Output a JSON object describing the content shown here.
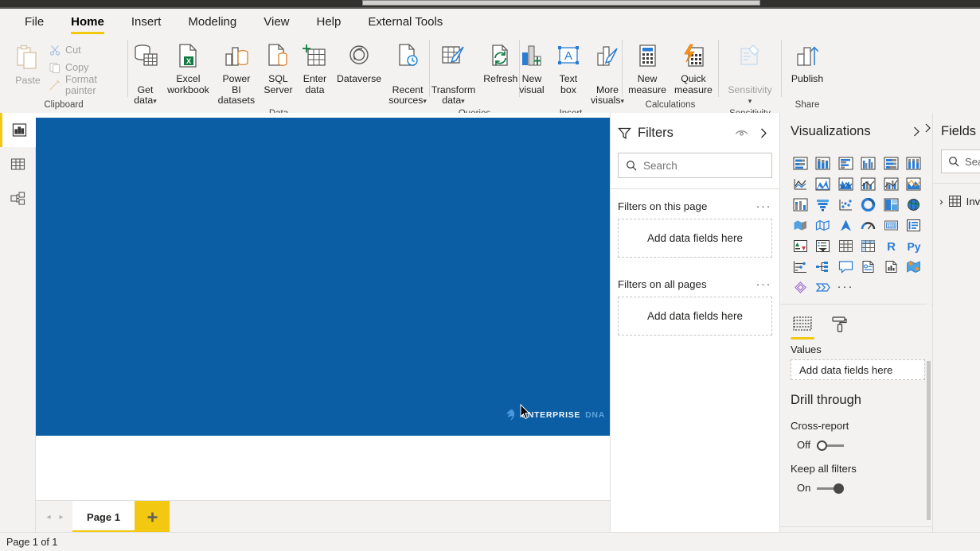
{
  "titlebar": {
    "segment": ""
  },
  "ribbon": {
    "tabs": [
      {
        "label": "File",
        "active": false
      },
      {
        "label": "Home",
        "active": true
      },
      {
        "label": "Insert",
        "active": false
      },
      {
        "label": "Modeling",
        "active": false
      },
      {
        "label": "View",
        "active": false
      },
      {
        "label": "Help",
        "active": false
      },
      {
        "label": "External Tools",
        "active": false
      }
    ],
    "groups": [
      {
        "name": "Clipboard",
        "label": "Clipboard",
        "paste": {
          "label": "Paste",
          "icon": "paste-icon"
        },
        "small": [
          {
            "label": "Cut",
            "icon": "cut-icon"
          },
          {
            "label": "Copy",
            "icon": "copy-icon"
          },
          {
            "label": "Format painter",
            "icon": "format-painter-icon"
          }
        ]
      },
      {
        "name": "Data",
        "label": "Data",
        "buttons": [
          {
            "label": "Get\ndata",
            "icon": "get-data-icon",
            "chevron": true
          },
          {
            "label": "Excel\nworkbook",
            "icon": "excel-workbook-icon",
            "chevron": false
          },
          {
            "label": "Power BI\ndatasets",
            "icon": "power-bi-datasets-icon",
            "chevron": false
          },
          {
            "label": "SQL\nServer",
            "icon": "sql-server-icon",
            "chevron": false
          },
          {
            "label": "Enter\ndata",
            "icon": "enter-data-icon",
            "chevron": false
          },
          {
            "label": "Dataverse",
            "icon": "dataverse-icon",
            "chevron": false
          },
          {
            "label": "Recent\nsources",
            "icon": "recent-sources-icon",
            "chevron": true
          }
        ]
      },
      {
        "name": "Queries",
        "label": "Queries",
        "buttons": [
          {
            "label": "Transform\ndata",
            "icon": "transform-data-icon",
            "chevron": true
          },
          {
            "label": "Refresh",
            "icon": "refresh-icon",
            "chevron": false
          }
        ]
      },
      {
        "name": "Insert",
        "label": "Insert",
        "buttons": [
          {
            "label": "New\nvisual",
            "icon": "new-visual-icon",
            "chevron": false
          },
          {
            "label": "Text\nbox",
            "icon": "text-box-icon",
            "chevron": false
          },
          {
            "label": "More\nvisuals",
            "icon": "more-visuals-icon",
            "chevron": true
          }
        ]
      },
      {
        "name": "Calculations",
        "label": "Calculations",
        "buttons": [
          {
            "label": "New\nmeasure",
            "icon": "new-measure-icon",
            "chevron": false
          },
          {
            "label": "Quick\nmeasure",
            "icon": "quick-measure-icon",
            "chevron": false
          }
        ]
      },
      {
        "name": "Sensitivity",
        "label": "Sensitivity",
        "buttons": [
          {
            "label": "Sensitivity",
            "icon": "sensitivity-icon",
            "chevron": true,
            "disabled": true
          }
        ]
      },
      {
        "name": "Share",
        "label": "Share",
        "buttons": [
          {
            "label": "Publish",
            "icon": "publish-icon",
            "chevron": false
          }
        ]
      }
    ]
  },
  "left_rail": [
    {
      "name": "report-view",
      "icon": "report-view-icon",
      "active": true
    },
    {
      "name": "data-view",
      "icon": "data-view-icon",
      "active": false
    },
    {
      "name": "model-view",
      "icon": "model-view-icon",
      "active": false
    }
  ],
  "canvas": {
    "background_color": "#0B5EA3",
    "watermark": {
      "primary": "ENTERPRISE",
      "secondary": "DNA",
      "logo": "enterprise-dna-logo"
    }
  },
  "page_tabs": {
    "prev": "◂",
    "next": "▸",
    "tabs": [
      {
        "label": "Page 1",
        "active": true
      }
    ],
    "add_label": "+"
  },
  "filters": {
    "title": "Filters",
    "eye_icon": "hide-filters-icon",
    "collapse_icon": "chevron-right-icon",
    "search": {
      "placeholder": "Search",
      "value": "",
      "icon": "search-icon"
    },
    "groups": [
      {
        "title": "Filters on this page",
        "menu": "···",
        "well": "Add data fields here"
      },
      {
        "title": "Filters on all pages",
        "menu": "···",
        "well": "Add data fields here"
      }
    ]
  },
  "visualizations": {
    "title": "Visualizations",
    "collapse_icon": "chevron-right-icon",
    "icons": [
      "stacked-bar-chart",
      "stacked-column-chart",
      "clustered-bar-chart",
      "clustered-column-chart",
      "100-stacked-bar-chart",
      "100-stacked-column-chart",
      "line-chart",
      "area-chart",
      "stacked-area-chart",
      "line-and-stacked-column-chart",
      "line-and-clustered-column-chart",
      "ribbon-chart-alt",
      "waterfall-chart",
      "funnel-chart",
      "scatter-chart",
      "pie-chart",
      "treemap-chart",
      "map-chart",
      "filled-map-chart",
      "shape-map-chart",
      "azure-map-chart",
      "gauge-chart",
      "card-visual",
      "multi-row-card",
      "kpi-visual",
      "slicer-visual",
      "table-visual",
      "matrix-visual",
      "r-script-visual",
      "python-visual",
      "key-influencers",
      "decomposition-tree",
      "qna-visual",
      "smart-narrative",
      "paginated-report",
      "arcgis-maps",
      "power-apps-visual",
      "power-automate-visual",
      "more-options"
    ],
    "field_tabs": [
      {
        "name": "fields-tab",
        "icon": "fields-tab-icon",
        "active": true
      },
      {
        "name": "format-tab",
        "icon": "format-paint-roller-icon",
        "active": false
      }
    ],
    "bucket_label": "Values",
    "bucket_well": "Add data fields here",
    "drill_through": {
      "title": "Drill through",
      "cross_report": {
        "label": "Cross-report",
        "state": "Off",
        "on": false
      },
      "keep_all_filters": {
        "label": "Keep all filters",
        "state": "On",
        "on": true
      }
    }
  },
  "fields": {
    "title": "Fields",
    "expand_icon": "chevron-right-icon",
    "search": {
      "placeholder": "Search",
      "icon": "search-icon"
    },
    "tables": [
      {
        "name": "Inv",
        "icon": "table-icon",
        "expander": "›"
      }
    ]
  },
  "status_bar": {
    "text": "Page 1 of 1"
  }
}
